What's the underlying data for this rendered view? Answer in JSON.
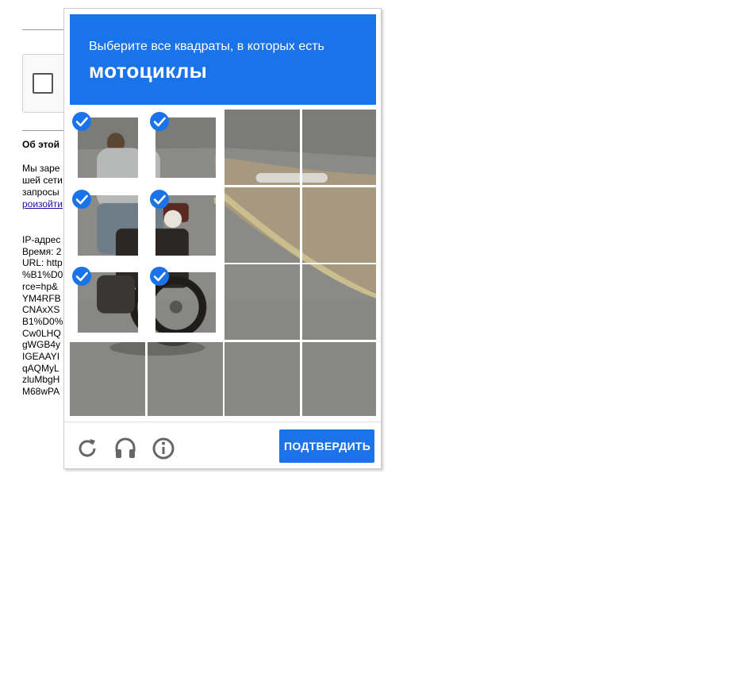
{
  "background_page": {
    "section_title": "Об этой",
    "paragraph_lines": [
      "Мы заре",
      "шей сети",
      "запросы"
    ],
    "link_text": "роизойти",
    "info_lines": [
      "IP-адрес",
      "Время: 2",
      "URL: http",
      "%B1%D0",
      "rce=hp&",
      "YM4RFB",
      "CNAxXS",
      "B1%D0%",
      "Cw0LHQ",
      "gWGB4y",
      "IGEAAYI",
      "qAQMyL",
      "zluMbgH",
      "M68wPA"
    ]
  },
  "challenge": {
    "instruction": "Выберите все квадраты, в которых есть",
    "target_object": "мотоциклы",
    "header_color": "#1a73e8",
    "selected_tiles": [
      0,
      1,
      4,
      5,
      8,
      9
    ],
    "tile_count": 16,
    "verify_label": "ПОДТВЕРДИТЬ",
    "icons": [
      "reload-icon",
      "headphones-icon",
      "info-icon"
    ]
  }
}
